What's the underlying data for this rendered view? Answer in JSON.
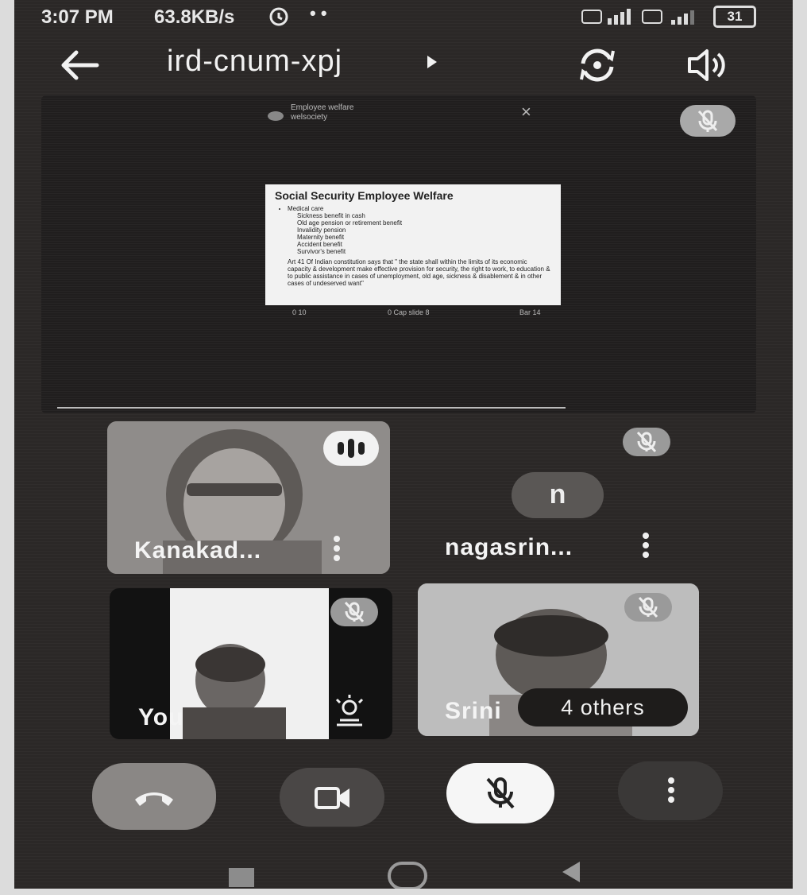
{
  "status_bar": {
    "time": "3:07 PM",
    "net_speed": "63.8KB/s",
    "more_dots": "• •",
    "battery": "31"
  },
  "header": {
    "meeting_code": "ird-cnum-xpj"
  },
  "presentation": {
    "org_name": "Employee welfare\nwelsociety",
    "close_glyph": "×",
    "slide_title": "Social Security Employee Welfare",
    "slide_bullets": [
      "Medical care"
    ],
    "slide_sub_bullets": [
      "Sickness benefit in cash",
      "Old age pension or retirement benefit",
      "Invalidity pension",
      "Maternity benefit",
      "Accident benefit",
      "Survivor's benefit"
    ],
    "slide_note": "Art 41 Of Indian constitution says that \" the state shall within the limits of its economic capacity & development make effective provision for security, the right to work, to education & to public assistance in cases of unemployment, old age, sickness & disablement & in other cases of undeserved want\"",
    "footer_left": "0 10",
    "footer_mid": "0 Cap slide 8",
    "footer_right": "Bar 14"
  },
  "participants": [
    {
      "name": "Kanakad..."
    },
    {
      "name": "nagasrin...",
      "avatar_letter": "n"
    },
    {
      "name": "You"
    },
    {
      "name": "Srini"
    }
  ],
  "others_count_label": "4 others"
}
